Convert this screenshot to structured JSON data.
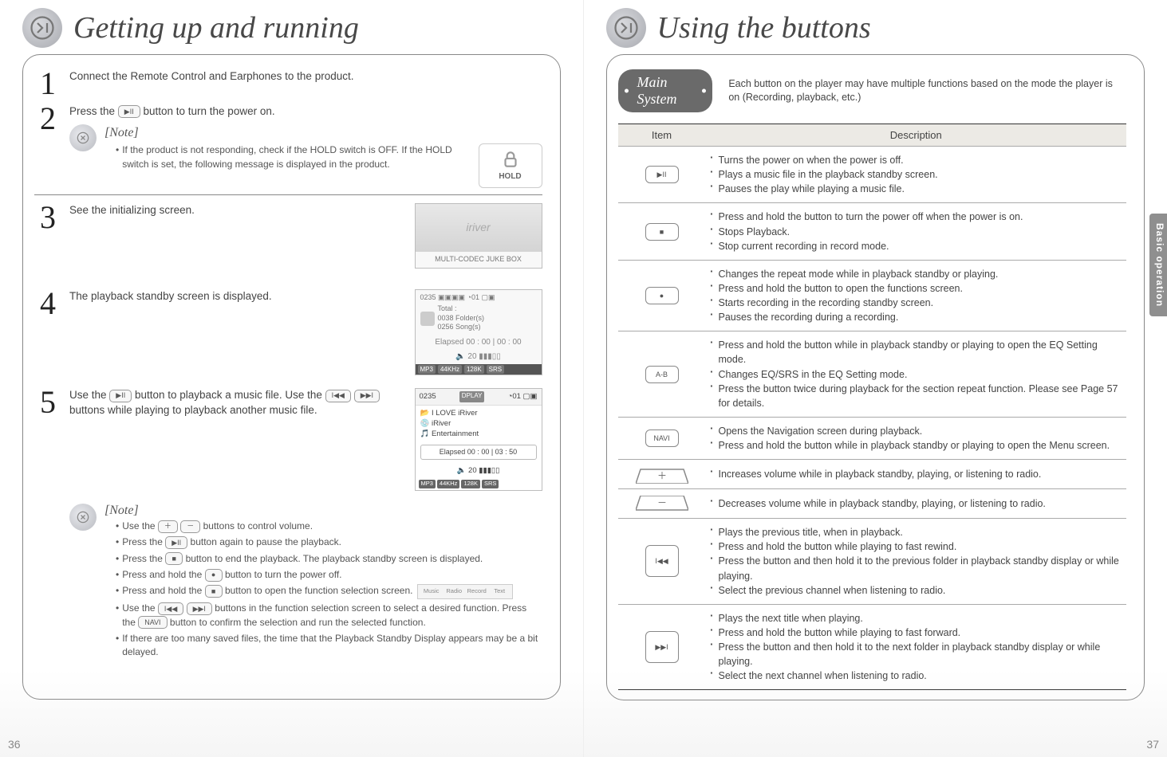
{
  "left": {
    "title": "Getting up and running",
    "steps": [
      {
        "num": "1",
        "text": "Connect the Remote Control and Earphones to the product."
      },
      {
        "num": "2",
        "text_before": "Press the ",
        "btn": "▶II",
        "text_after": " button to turn the power on."
      },
      {
        "num": "3",
        "text": "See the initializing screen."
      },
      {
        "num": "4",
        "text": "The playback standby screen is displayed."
      },
      {
        "num": "5",
        "text_before": "Use the ",
        "btn": "▶II",
        "text_mid": " button to playback a music file. Use the ",
        "btn2a": "I◀◀",
        "btn2b": "▶▶I",
        "text_after": " buttons while playing to playback another music file."
      }
    ],
    "note_label": "[Note]",
    "note1": "If the product is not responding, check if the HOLD switch is OFF. If the HOLD switch is set, the following message is displayed in the product.",
    "hold_label": "HOLD",
    "screenshot1": {
      "logo": "iriver",
      "sub": "MULTI-CODEC JUKE BOX"
    },
    "screenshot_standby": {
      "topline": "0235  ▣▣▣▣  ◔01  ▢▣",
      "l1": "Total :",
      "l2": "0038 Folder(s)",
      "l3": "0256 Song(s)",
      "time": "Elapsed 00 : 00 | 00 : 00",
      "vol": "🔈 20 ▮▮▮▯▯",
      "bar": [
        "MP3",
        "44KHz",
        "128K",
        "SRS"
      ]
    },
    "screenshot_play": {
      "top_l": "0235",
      "top_r": "◔01  ▢▣",
      "dplay": "DPLAY",
      "l1": "📂 I LOVE iRiver",
      "l2": "💿 iRiver",
      "l3": "🎵 Entertainment",
      "time": "Elapsed 00 : 00 | 03 : 50",
      "vol": "🔈 20 ▮▮▮▯▯",
      "bar": [
        "MP3",
        "44KHz",
        "128K",
        "SRS"
      ]
    },
    "note2_items": [
      {
        "pre": "Use the ",
        "btns": [
          "＋",
          "－"
        ],
        "post": " buttons to control volume."
      },
      {
        "pre": "Press the ",
        "btns": [
          "▶II"
        ],
        "post": " button again to pause the playback."
      },
      {
        "pre": "Press the ",
        "btns": [
          "■"
        ],
        "post": " button to end the playback. The playback standby screen is displayed."
      },
      {
        "pre": "Press and hold the ",
        "btns": [
          "●"
        ],
        "post": " button to turn the power off."
      },
      {
        "pre": "Press and hold the ",
        "btns": [
          "■"
        ],
        "post": " button to open the function selection screen."
      },
      {
        "pre": "Use the ",
        "btns": [
          "I◀◀",
          "▶▶I"
        ],
        "post": " buttons in the function selection screen to select a desired function. Press the ",
        "btns2": [
          "NAVI"
        ],
        "post2": " button to confirm the selection and run the selected function."
      },
      {
        "pre": "",
        "btns": [],
        "post": "If there are too many saved files, the time that the Playback Standby Display appears may be a bit delayed."
      }
    ],
    "func_sel": [
      "Music",
      "Radio",
      "Record",
      "Text"
    ],
    "pagenum": "36"
  },
  "right": {
    "title": "Using the buttons",
    "pill": "Main System",
    "pill_desc": "Each button on the player may have multiple functions based on the mode the player is on (Recording, playback, etc.)",
    "col_item": "Item",
    "col_desc": "Description",
    "rows": [
      {
        "btn": "▶II",
        "shape": "rect",
        "points": [
          "Turns the power on when the power is off.",
          "Plays a music file in the playback standby screen.",
          "Pauses the play while playing a music file."
        ]
      },
      {
        "btn": "■",
        "shape": "rect",
        "points": [
          "Press and hold the button to turn the power off when the power is on.",
          "Stops Playback.",
          "Stop current recording in record mode."
        ]
      },
      {
        "btn": "●",
        "shape": "rect",
        "points": [
          "Changes the repeat mode while in playback standby or playing.",
          "Press and hold the button to open the functions screen.",
          "Starts recording in the recording standby screen.",
          "Pauses the recording during a recording."
        ]
      },
      {
        "btn": "A-B",
        "shape": "rect",
        "points": [
          "Press and hold the button while in playback standby or playing to open the EQ Setting mode.",
          "Changes EQ/SRS in the EQ Setting mode.",
          "Press the button twice during playback for the section repeat function. Please see Page 57 for details."
        ]
      },
      {
        "btn": "NAVI",
        "shape": "rect",
        "points": [
          "Opens the Navigation screen during playback.",
          "Press and hold the button while in playback standby or playing to open the Menu screen."
        ]
      },
      {
        "btn": "＋",
        "shape": "wedge-up",
        "points": [
          "Increases volume while in playback standby, playing, or listening to radio."
        ]
      },
      {
        "btn": "－",
        "shape": "wedge-down",
        "points": [
          "Decreases volume while in playback standby, playing, or listening to radio."
        ]
      },
      {
        "btn": "I◀◀",
        "shape": "tall",
        "points": [
          "Plays the previous title, when in playback.",
          "Press and hold the button while playing to fast rewind.",
          "Press the button and then hold it to the previous folder in playback standby display or while playing.",
          "Select the previous channel when listening to radio."
        ]
      },
      {
        "btn": "▶▶I",
        "shape": "tall",
        "points": [
          "Plays the next title when playing.",
          "Press and hold the button while playing to fast forward.",
          "Press the button and then hold it to the next folder in playback standby display or while playing.",
          "Select the next channel when listening to radio."
        ]
      }
    ],
    "side_tab": "Basic operation",
    "pagenum": "37"
  }
}
